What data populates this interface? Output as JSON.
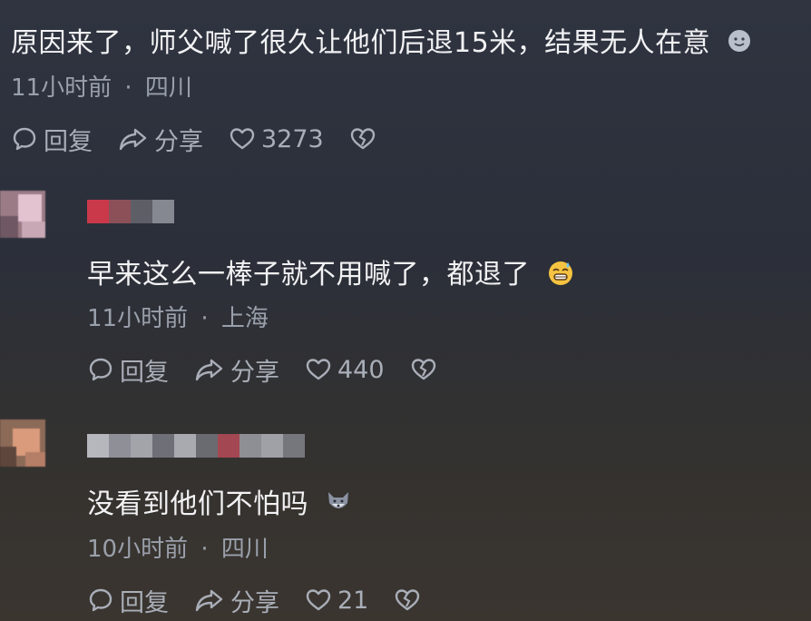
{
  "comments": [
    {
      "text": "原因来了，师父喊了很久让他们后退15米，结果无人在意",
      "emoji": "smiling-face-icon",
      "time": "11小时前",
      "separator": "·",
      "location": "四川",
      "reply_label": "回复",
      "share_label": "分享",
      "likes": "3273"
    },
    {
      "text": "早来这么一棒子就不用喊了，都退了",
      "emoji": "grinning-sweat-face-icon",
      "time": "11小时前",
      "separator": "·",
      "location": "上海",
      "reply_label": "回复",
      "share_label": "分享",
      "likes": "440"
    },
    {
      "text": "没看到他们不怕吗",
      "emoji": "wolf-face-icon",
      "time": "10小时前",
      "separator": "·",
      "location": "四川",
      "reply_label": "回复",
      "share_label": "分享",
      "likes": "21"
    }
  ],
  "colors": {
    "primary_text": "#f2f2f4",
    "secondary_text": "#9aa0ab",
    "accent_red": "#d94a56"
  }
}
